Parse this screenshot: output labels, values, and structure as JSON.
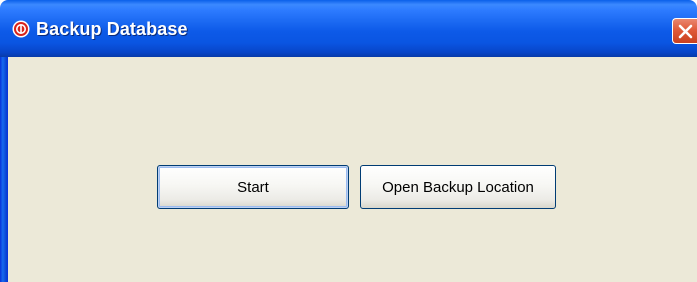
{
  "window": {
    "title": "Backup Database",
    "icon": "app-record-icon",
    "close_icon": "close-icon"
  },
  "buttons": {
    "start_label": "Start",
    "open_location_label": "Open Backup Location"
  },
  "colors": {
    "titlebar_blue": "#0a55e2",
    "client_background": "#ece9d8",
    "close_button_red": "#e05a3a",
    "button_border": "#003c74"
  }
}
